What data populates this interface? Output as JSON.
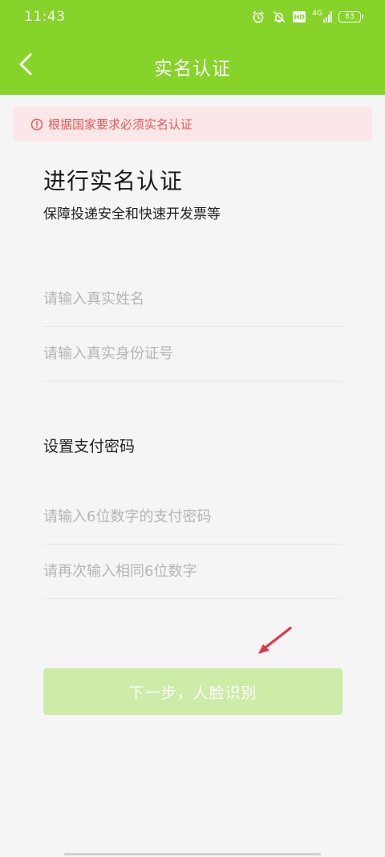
{
  "status_bar": {
    "time": "11:43",
    "hd_label": "HD",
    "signal_label": "4G",
    "battery": "83",
    "icons": [
      "alarm-icon",
      "bell-off-icon",
      "hd-icon",
      "signal-icon",
      "battery-icon"
    ]
  },
  "nav": {
    "title": "实名认证",
    "back_icon": "chevron-left-icon"
  },
  "notice": {
    "icon": "exclamation-circle-icon",
    "text": "根据国家要求必须实名认证"
  },
  "content": {
    "heading": "进行实名认证",
    "subheading": "保障投递安全和快速开发票等"
  },
  "form": {
    "name_placeholder": "请输入真实姓名",
    "id_placeholder": "请输入真实身份证号",
    "password_section_label": "设置支付密码",
    "password_placeholder": "请输入6位数字的支付密码",
    "password_confirm_placeholder": "请再次输入相同6位数字"
  },
  "actions": {
    "next_label": "下一步，人脸识别"
  },
  "colors": {
    "brand_green": "#86d32a",
    "button_disabled": "#cdeca7",
    "notice_bg": "#fbe7e7",
    "notice_text": "#e45a5a",
    "annotation_arrow": "#e03a4a"
  }
}
